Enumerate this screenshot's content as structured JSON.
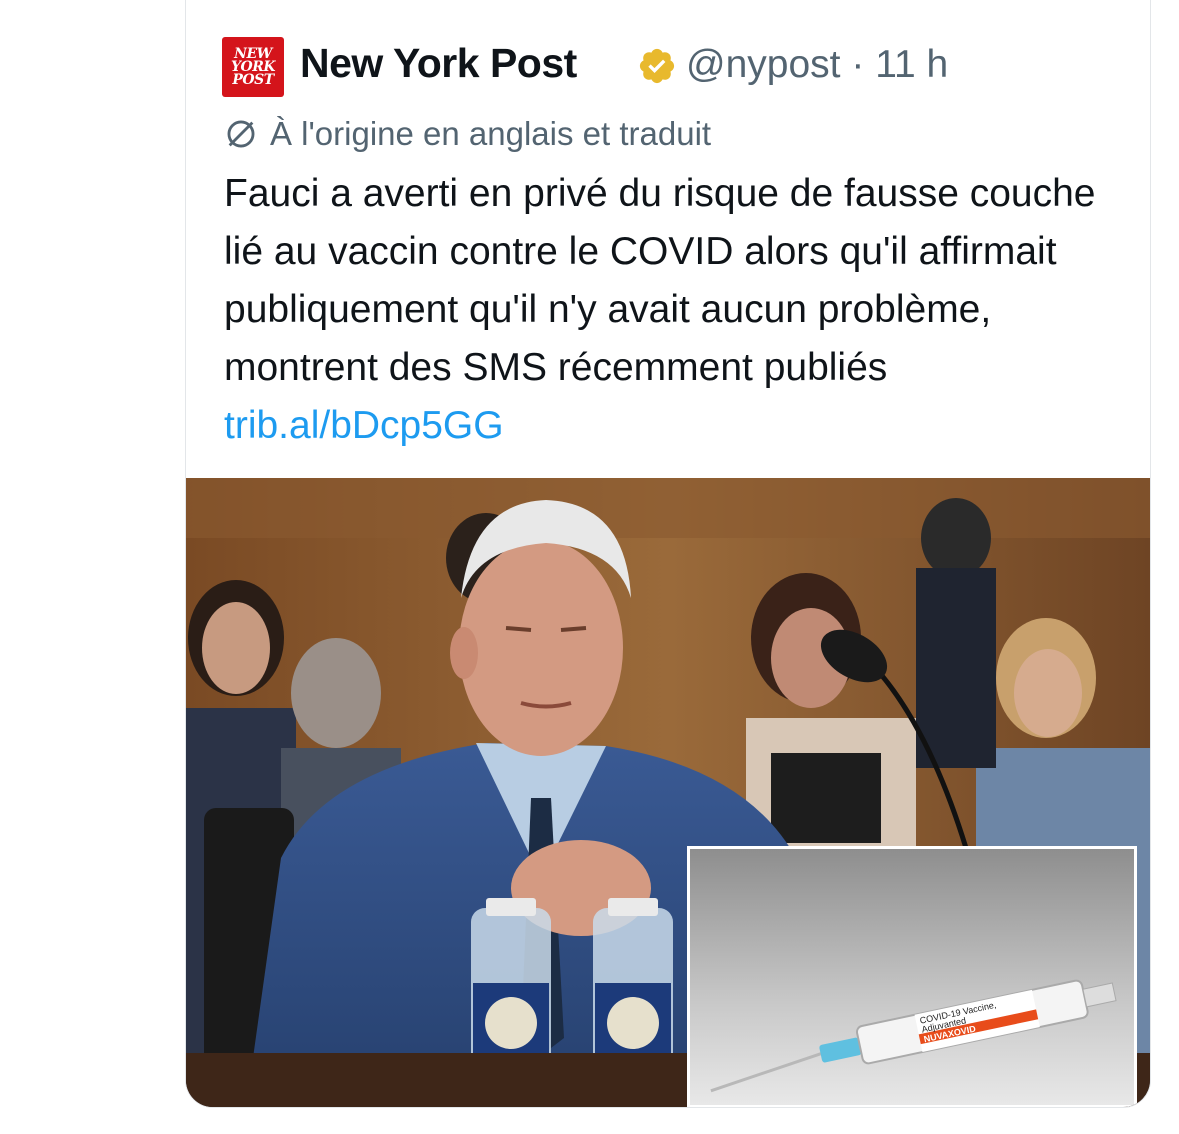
{
  "tweet": {
    "logo_lines": [
      "NEW",
      "YORK",
      "POST"
    ],
    "display_name": "New York Post",
    "handle": "@nypost",
    "separator": "·",
    "time": "11 h",
    "translated_label": "À l'origine en anglais et traduit",
    "text": "Fauci a averti en privé du risque de fausse couche lié au vaccin contre le COVID alors qu'il affirmait publiquement qu'il n'y avait aucun problème, montrent des SMS récemment publiés",
    "link": "trib.al/bDcp5GG"
  },
  "inset_label": {
    "line1": "COVID-19 Vaccine,",
    "line2": "Adjuvanted",
    "line3": "NUVAXOVID"
  },
  "colors": {
    "accent_link": "#1d9bf0",
    "brand_red": "#d4141b",
    "verified_gold": "#e8b92d",
    "secondary_text": "#536471"
  },
  "icons": {
    "verified": "verified-badge-icon",
    "translate": "translate-icon"
  }
}
